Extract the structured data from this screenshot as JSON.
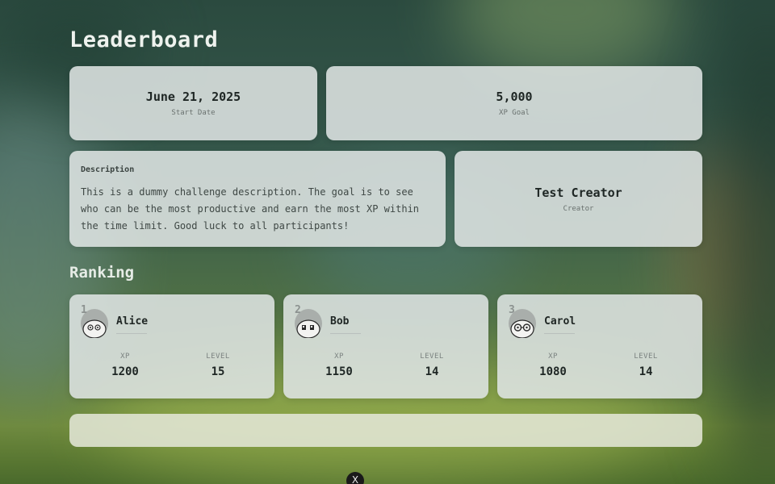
{
  "page": {
    "title": "Leaderboard",
    "start_date": {
      "value": "June 21, 2025",
      "label": "Start Date"
    },
    "xp_goal": {
      "value": "5,000",
      "label": "XP Goal"
    },
    "description": {
      "title": "Description",
      "text": "This is a dummy challenge description. The goal is to see who can be the most productive and earn the most XP within the time limit. Good luck to all participants!"
    },
    "creator": {
      "name": "Test Creator",
      "label": "Creator"
    },
    "ranking_title": "Ranking"
  },
  "players": [
    {
      "rank": "1",
      "name": "Alice",
      "xp_label": "XP",
      "xp": "1200",
      "level_label": "LEVEL",
      "level": "15"
    },
    {
      "rank": "2",
      "name": "Bob",
      "xp_label": "XP",
      "xp": "1150",
      "level_label": "LEVEL",
      "level": "14"
    },
    {
      "rank": "3",
      "name": "Carol",
      "xp_label": "XP",
      "xp": "1080",
      "level_label": "LEVEL",
      "level": "14"
    }
  ],
  "close_button": {
    "icon": "close-icon",
    "glyph": "X"
  }
}
